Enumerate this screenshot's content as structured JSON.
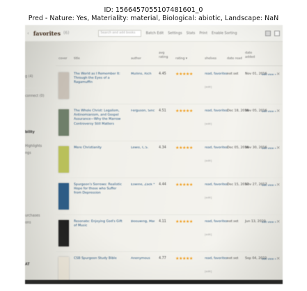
{
  "caption": {
    "line1": "ID: 1566457055107481601_0",
    "line2": "Pred - Nature: Yes, Materiality: material, Biological: abiotic, Landscape: NaN"
  },
  "topbar": {
    "title": "favorites",
    "count": "(6)",
    "search_placeholder": "Search and add books",
    "links": [
      "Batch Edit",
      "Settings",
      "Stats",
      "Print",
      "Enable Sorting"
    ],
    "view_icons": [
      "grid-view-icon",
      "list-view-icon"
    ]
  },
  "sidebar": {
    "items": [
      "g (4)",
      "connect (0)",
      "bility",
      "Highlights",
      "ngs",
      "urchases",
      "ons",
      "AT"
    ]
  },
  "columns": {
    "cover": "cover",
    "title": "title",
    "author": "author",
    "rating_avg": "avg rating",
    "rating": "rating ▾",
    "shelves": "shelves",
    "date_read": "date read",
    "date_added": "date added"
  },
  "books": [
    {
      "title": "The World as I Remember It: Through the Eyes of a Ragamuffin",
      "author": "Mullins, Rich",
      "avg_rating": "4.45",
      "stars": "★★★★★",
      "shelves": "read, favorites",
      "edit": "[edit]",
      "date_read": "not set",
      "date_added": "Nov 01, 2016",
      "view": "edit view »",
      "cover_color": "#c8c0b6"
    },
    {
      "title": "The Whole Christ: Legalism, Antinomianism, and Gospel Assurance—Why the Marrow Controversy Still Matters",
      "author": "Ferguson, Sinclair B.",
      "avg_rating": "4.51",
      "stars": "★★★★★",
      "shelves": "read, favorites",
      "edit": "[edit]",
      "date_read": "Dec 18, 2016",
      "date_added": "Nov 05, 2016",
      "view": "edit view »",
      "cover_color": "#6f7f6a"
    },
    {
      "title": "Mere Christianity",
      "author": "Lewis, C.S.",
      "avg_rating": "4.34",
      "stars": "★★★★★",
      "shelves": "read, favorites",
      "edit": "[edit]",
      "date_read": "Dec 05, 2016",
      "date_added": "Nov 30, 2016",
      "view": "edit view »",
      "cover_color": "#b9c05a"
    },
    {
      "title": "Spurgeon's Sorrows: Realistic Hope for those who Suffer from Depression",
      "author": "Eswine, Zack *",
      "avg_rating": "4.44",
      "stars": "★★★★★",
      "shelves": "read, favorites",
      "edit": "[edit]",
      "date_read": "Dec 15, 2017",
      "date_added": "Nov 27, 2017",
      "view": "edit view »",
      "cover_color": "#2d5c86"
    },
    {
      "title": "Resonate: Enjoying God's Gift of Music",
      "author": "Beeuwing, Mark",
      "avg_rating": "4.11",
      "stars": "★★★★★",
      "shelves": "read, favorites",
      "edit": "[edit]",
      "date_read": "not set",
      "date_added": "Jun 13, 2020",
      "view": "edit view »",
      "cover_color": "#1e1e1e"
    },
    {
      "title": "CSB Spurgeon Study Bible",
      "author": "Anonymous",
      "avg_rating": "4.77",
      "stars": "★★★★★",
      "shelves": "read, favorites",
      "edit": "[edit]",
      "date_read": "not set",
      "date_added": "Sep 04, 2022",
      "view": "edit view »",
      "cover_color": "#efe9dc"
    }
  ]
}
